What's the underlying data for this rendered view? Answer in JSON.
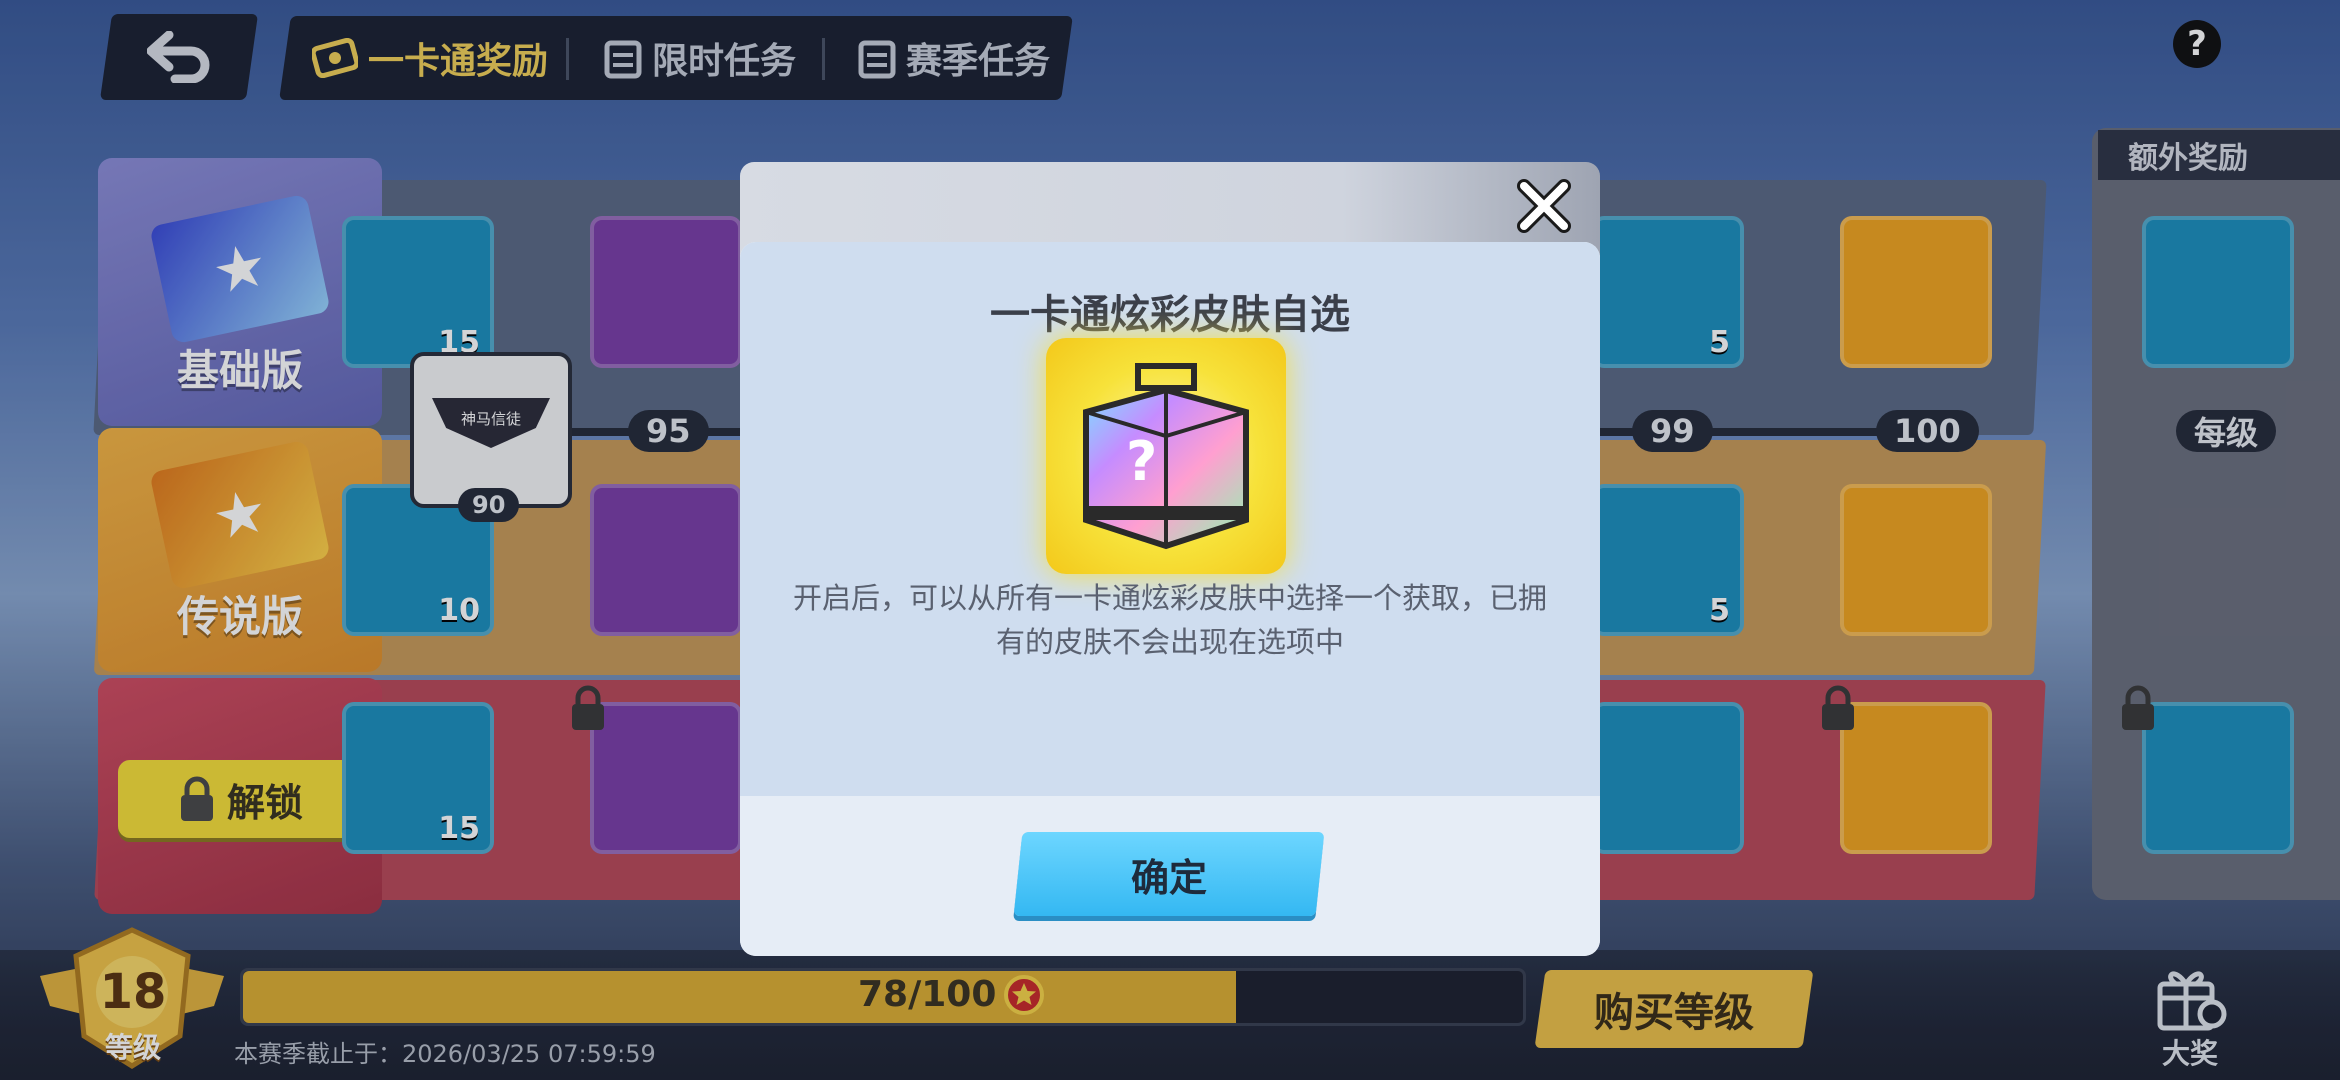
{
  "header": {
    "tabs": [
      {
        "label": "一卡通奖励",
        "active": true
      },
      {
        "label": "限时任务",
        "active": false
      },
      {
        "label": "赛季任务",
        "active": false
      }
    ],
    "help_symbol": "?"
  },
  "tiers": [
    {
      "label": "基础版"
    },
    {
      "label": "传说版"
    },
    {
      "label": "解锁"
    }
  ],
  "milestone": {
    "banner": "神马信徒",
    "level": "90"
  },
  "levels": {
    "l95": "95",
    "l99": "99",
    "l100": "100",
    "each": "每级"
  },
  "items": {
    "r1a_count": "15",
    "r2a_count": "10",
    "r3a_count": "15",
    "r1b_count": "5",
    "r2b_count": "5"
  },
  "extra": {
    "header": "额外奖励"
  },
  "progress": {
    "label": "78/100",
    "current": 78,
    "max": 100,
    "season_end": "本赛季截止于：2026/03/25 07:59:59",
    "level_value": "18",
    "level_label": "等级",
    "buy_label": "购买等级",
    "grand_label": "大奖"
  },
  "modal": {
    "title": "一卡通炫彩皮肤自选",
    "description": "开启后，可以从所有一卡通炫彩皮肤中选择一个获取，已拥有的皮肤不会出现在选项中",
    "confirm_label": "确定"
  },
  "colors": {
    "accent": "#f1d05a",
    "confirm": "#4cc8fa",
    "xp_fill": "#dcae34"
  }
}
